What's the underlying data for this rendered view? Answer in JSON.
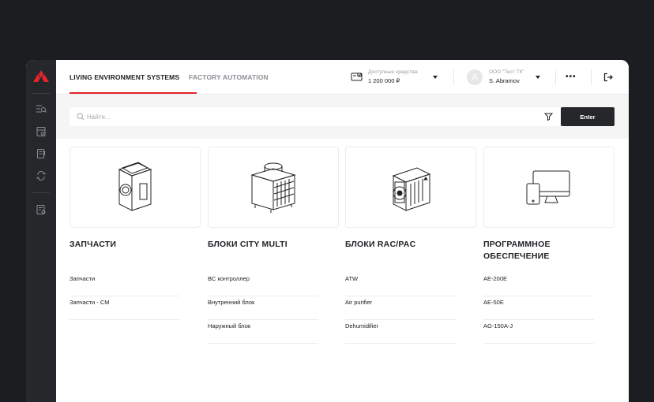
{
  "header": {
    "tabs": [
      {
        "label": "LIVING ENVIRONMENT SYSTEMS",
        "active": true
      },
      {
        "label": "FACTORY AUTOMATION",
        "active": false
      }
    ],
    "funds": {
      "label": "Доступные средства:",
      "value": "1 200 000 ₽",
      "icon": "wallet-icon"
    },
    "user": {
      "org": "ООО \"Тест ТК\"",
      "name": "S. Abramov",
      "icon": "user-icon"
    },
    "more_label": "•••",
    "logout_icon": "logout-icon"
  },
  "sidebar": {
    "brand_color": "#e3242b",
    "items": [
      "list-icon",
      "calculator-icon",
      "document-icon",
      "recycle-icon",
      "report-icon"
    ]
  },
  "search": {
    "placeholder": "Найти...",
    "button_label": "Enter"
  },
  "categories": [
    {
      "title": "ЗАПЧАСТИ",
      "image": "spare-parts-box-illustration",
      "links": [
        "Запчасти",
        "Запчасти - CM"
      ]
    },
    {
      "title": "БЛОКИ CITY MULTI",
      "image": "city-multi-unit-illustration",
      "links": [
        "BC контроллер",
        "Внутренний блок",
        "Наружный блок"
      ]
    },
    {
      "title": "БЛОКИ RAC/PAC",
      "image": "outdoor-unit-illustration",
      "links": [
        "ATW",
        "Air purifier",
        "Dehumidifier"
      ]
    },
    {
      "title": "ПРОГРАММНОЕ ОБЕСПЕЧЕНИЕ",
      "image": "software-devices-illustration",
      "links": [
        "AE-200E",
        "AE-50E",
        "AG-150A-J"
      ]
    }
  ],
  "colors": {
    "accent": "#e3242b",
    "dark": "#25272b",
    "background": "#1b1d20"
  }
}
